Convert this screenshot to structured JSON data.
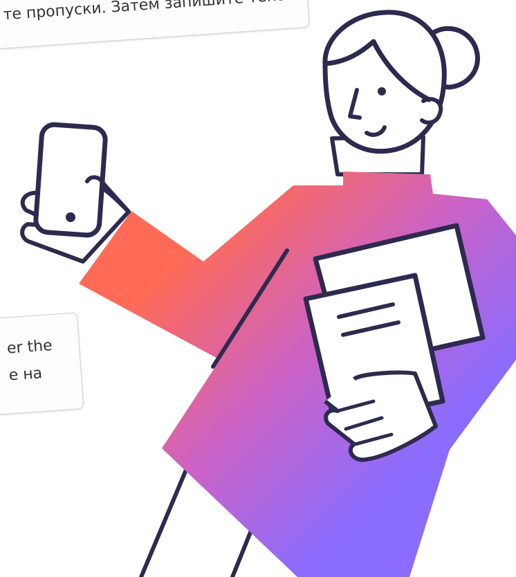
{
  "instruction_card": {
    "text": "те пропуски. Затем запишите текст"
  },
  "hint_card": {
    "line1": "er the",
    "line2": "е на"
  },
  "colors": {
    "outline": "#2e2a4f",
    "gradient_start": "#ff6b57",
    "gradient_mid": "#cc62c4",
    "gradient_end": "#8a6cff",
    "paper": "#ffffff"
  },
  "icons": [
    "person-illustration",
    "smartphone-icon",
    "documents-icon"
  ]
}
